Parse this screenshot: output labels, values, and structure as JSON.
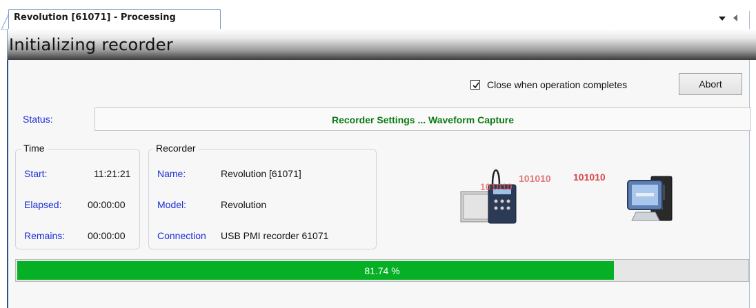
{
  "tab": {
    "title": "Revolution [61071]  - Processing"
  },
  "header": {
    "title": "Initializing recorder"
  },
  "options": {
    "close_when_complete_label": "Close when operation completes",
    "close_when_complete_checked": true,
    "abort_label": "Abort"
  },
  "status": {
    "label": "Status:",
    "text": "Recorder Settings ... Waveform Capture"
  },
  "time": {
    "title": "Time",
    "start_label": "Start:",
    "start_value": "11:21:21",
    "elapsed_label": "Elapsed:",
    "elapsed_value": "00:00:00",
    "remains_label": "Remains:",
    "remains_value": "00:00:00"
  },
  "recorder": {
    "title": "Recorder",
    "name_label": "Name:",
    "name_value": "Revolution [61071]",
    "model_label": "Model:",
    "model_value": "Revolution",
    "connection_label": "Connection",
    "connection_value": "USB PMI recorder 61071"
  },
  "illustration": {
    "bits": [
      "101010",
      "101010",
      "101010"
    ],
    "left_icon": "recorder-device-icon",
    "right_icon": "computer-icon"
  },
  "progress": {
    "percent": 81.74,
    "label": "81.74 %",
    "fill_color": "#06b025"
  },
  "colors": {
    "label_blue": "#1c2fd6",
    "status_green": "#0c7a12",
    "bits_red": "#e06060"
  }
}
